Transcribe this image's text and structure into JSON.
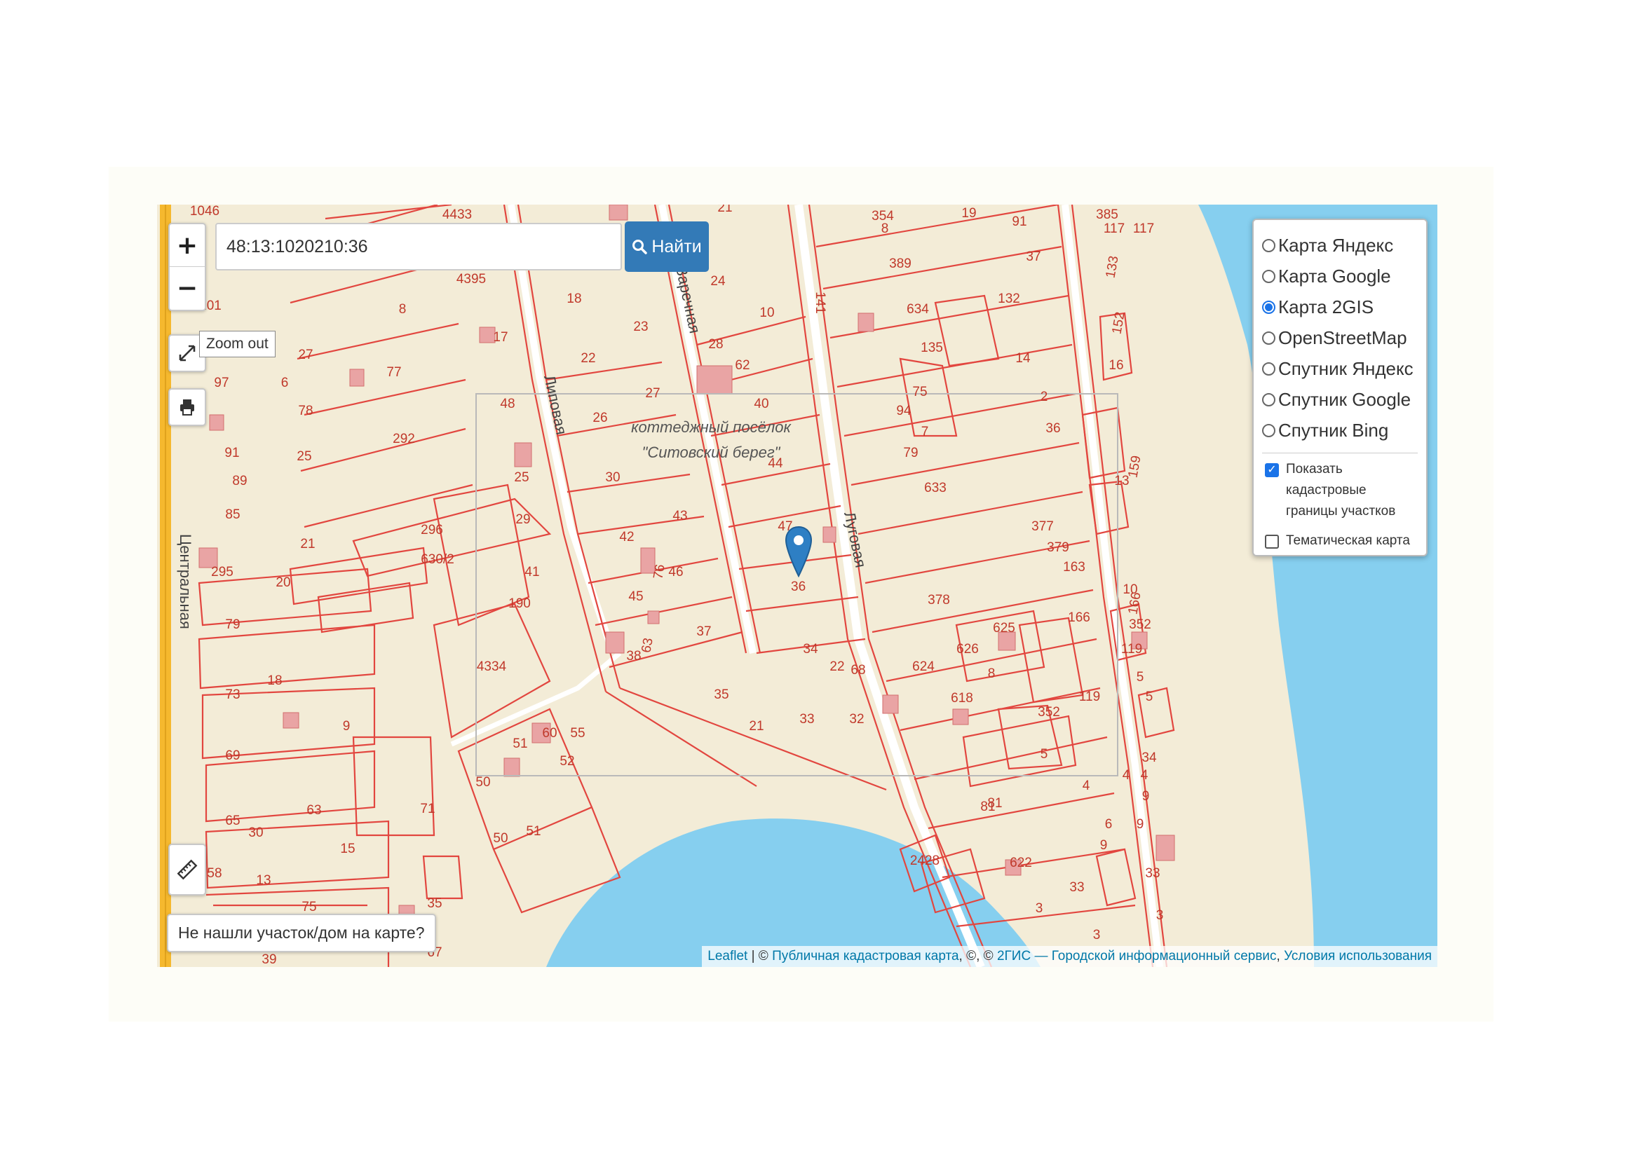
{
  "search": {
    "value": "48:13:1020210:36",
    "button_label": "Найти"
  },
  "tooltip": {
    "zoom_out": "Zoom out"
  },
  "zoom": {
    "in_label": "+",
    "out_label": "−"
  },
  "layers": {
    "options": [
      {
        "label": "Карта Яндекс",
        "selected": false
      },
      {
        "label": "Карта Google",
        "selected": false
      },
      {
        "label": "Карта 2GIS",
        "selected": true
      },
      {
        "label": "OpenStreetMap",
        "selected": false
      },
      {
        "label": "Спутник Яндекс",
        "selected": false
      },
      {
        "label": "Спутник Google",
        "selected": false
      },
      {
        "label": "Спутник Bing",
        "selected": false
      }
    ],
    "checkboxes": [
      {
        "label": "Показать кадастровые границы участков",
        "checked": true
      },
      {
        "label": "Тематическая карта",
        "checked": false
      }
    ]
  },
  "not_found_button": "Не нашли участок/дом на карте?",
  "attribution": {
    "leaflet": "Leaflet",
    "sep": " | © ",
    "pkk": "Публичная кадастровая карта",
    "mid": ", ©, © ",
    "gis": "2ГИС — Городской информационный сервис",
    "comma": ", ",
    "terms": "Условия использования"
  },
  "map": {
    "settlement_line1": "коттеджный посёлок",
    "settlement_line2": "\"Ситовский берег\"",
    "streets": [
      "Липовая",
      "Заречная",
      "Луговая",
      "Центральная"
    ],
    "parcel_numbers": [
      "354",
      "91",
      "385",
      "117",
      "389",
      "37",
      "133",
      "141",
      "152",
      "634",
      "132",
      "135",
      "14",
      "16",
      "2",
      "94",
      "79",
      "36",
      "633",
      "377",
      "379",
      "163",
      "166",
      "378",
      "625",
      "626",
      "624",
      "618",
      "352",
      "119",
      "5",
      "4",
      "34",
      "6",
      "81",
      "622",
      "9",
      "33",
      "3",
      "2428",
      "18",
      "23",
      "24",
      "10",
      "28",
      "62",
      "22",
      "27",
      "40",
      "26",
      "30",
      "44",
      "43",
      "42",
      "47",
      "46",
      "76",
      "41",
      "45",
      "38",
      "63",
      "37",
      "35",
      "34",
      "33",
      "32",
      "21",
      "68",
      "22",
      "29",
      "25",
      "9",
      "48",
      "17",
      "8",
      "77",
      "78",
      "6",
      "27",
      "292",
      "21",
      "296",
      "630/2",
      "295",
      "20",
      "190",
      "4334",
      "18",
      "9",
      "55",
      "52",
      "51",
      "60",
      "50",
      "51",
      "71",
      "63",
      "30",
      "15",
      "13",
      "75",
      "35",
      "67",
      "39",
      "101",
      "97",
      "91",
      "89",
      "85",
      "79",
      "73",
      "69",
      "65",
      "58",
      "1046",
      "4433",
      "4395"
    ],
    "marker_parcel": "36"
  },
  "colors": {
    "map_bg": "#f3ecd7",
    "boundary": "#e2463f",
    "water": "#86cfef",
    "road": "#ffffff",
    "main_road": "#f5b82e",
    "marker": "#2e7fc4",
    "button": "#337ab7"
  },
  "icons": [
    "fullscreen-icon",
    "print-icon",
    "ruler-icon",
    "search-icon",
    "map-marker-icon"
  ]
}
